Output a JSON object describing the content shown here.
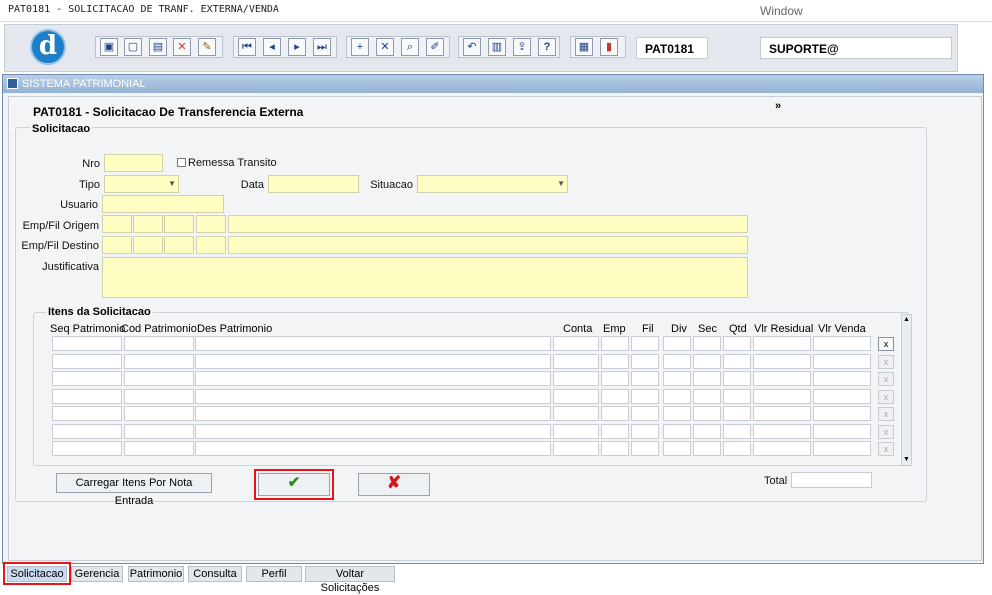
{
  "window": {
    "title": "PAT0181 - SOLICITACAO DE TRANF. EXTERNA/VENDA",
    "menu": "Window"
  },
  "toolbar": {
    "logo_letter": "d",
    "form_code": "PAT0181",
    "user": "SUPORTE@",
    "buttons": [
      "save-icon",
      "print-preview-icon",
      "print-icon",
      "delete-record-icon",
      "edit-icon",
      "first-record-icon",
      "prev-record-icon",
      "next-record-icon",
      "last-record-icon",
      "insert-icon",
      "remove-icon",
      "query-icon",
      "clear-icon",
      "undo-icon",
      "copy-icon",
      "export-icon",
      "help-icon",
      "calculator-icon",
      "exit-icon"
    ]
  },
  "app": {
    "name": "SISTEMA PATRIMONIAL"
  },
  "form": {
    "title": "PAT0181 - Solicitacao De Transferencia Externa",
    "more": "»",
    "section": "Solicitacao",
    "labels": {
      "nro": "Nro",
      "remessa": "Remessa Transito",
      "tipo": "Tipo",
      "data": "Data",
      "situacao": "Situacao",
      "usuario": "Usuario",
      "origem": "Emp/Fil Origem",
      "destino": "Emp/Fil Destino",
      "justificativa": "Justificativa"
    }
  },
  "items": {
    "title": "Itens da Solicitacao",
    "columns": [
      "Seq Patrimonio",
      "Cod Patrimonio",
      "Des Patrimonio",
      "Conta",
      "Emp",
      "Fil",
      "Div",
      "Sec",
      "Qtd",
      "Vlr Residual",
      "Vlr Venda"
    ],
    "row_count": 7,
    "row_button": "x"
  },
  "actions": {
    "load_items": "Carregar Itens Por Nota Entrada",
    "confirm_icon": "✔",
    "cancel_icon": "✘",
    "total_label": "Total"
  },
  "tabs": [
    "Solicitacao",
    "Gerencia",
    "Patrimonio",
    "Consulta",
    "Perfil",
    "Voltar Solicitações"
  ],
  "colors": {
    "field_yellow": "#ffffc4",
    "highlight_red": "#e8141a",
    "confirm_green": "#2a8a1e",
    "cancel_red": "#d81414"
  }
}
